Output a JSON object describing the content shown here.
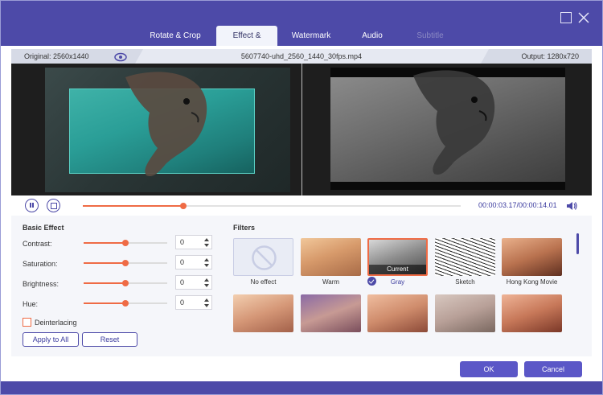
{
  "tabs": [
    {
      "label": "Rotate & Crop"
    },
    {
      "label": "Effect & Filter"
    },
    {
      "label": "Watermark"
    },
    {
      "label": "Audio"
    },
    {
      "label": "Subtitle"
    }
  ],
  "info": {
    "original": "Original: 2560x1440",
    "filename": "5607740-uhd_2560_1440_30fps.mp4",
    "output": "Output: 1280x720"
  },
  "playback": {
    "timecode": "00:00:03.17/00:00:14.01",
    "progress_percent": 26.5
  },
  "basic_effect": {
    "title": "Basic Effect",
    "rows": [
      {
        "label": "Contrast:",
        "value": "0",
        "level": 0.5
      },
      {
        "label": "Saturation:",
        "value": "0",
        "level": 0.5
      },
      {
        "label": "Brightness:",
        "value": "0",
        "level": 0.5
      },
      {
        "label": "Hue:",
        "value": "0",
        "level": 0.5
      }
    ],
    "deinterlacing_label": "Deinterlacing",
    "apply_all_label": "Apply to All",
    "reset_label": "Reset"
  },
  "filters": {
    "title": "Filters",
    "items": [
      {
        "label": "No effect"
      },
      {
        "label": "Warm"
      },
      {
        "label": "Gray",
        "current_tag": "Current"
      },
      {
        "label": "Sketch"
      },
      {
        "label": "Hong Kong Movie"
      }
    ]
  },
  "footer": {
    "ok_label": "OK",
    "cancel_label": "Cancel"
  },
  "colors": {
    "accent": "#4d4aa8",
    "slider": "#ef6b45",
    "button": "#5b57c7"
  }
}
